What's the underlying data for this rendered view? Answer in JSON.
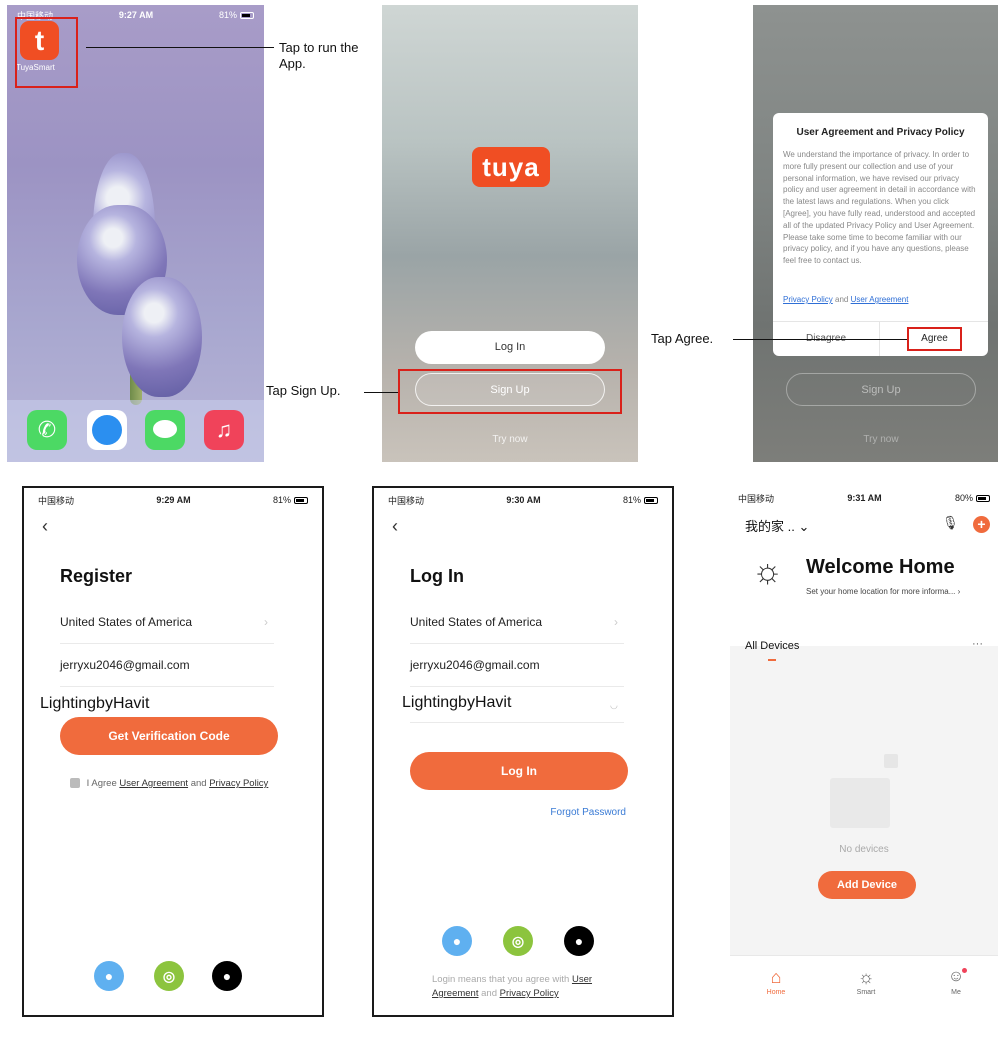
{
  "screen1": {
    "status": {
      "carrier": "中国移动",
      "time": "9:27 AM",
      "battery": "81%"
    },
    "app_label": "TuyaSmart",
    "app_icon_letter": "t",
    "callout": "Tap to run the App.",
    "dock_icons": [
      "phone-icon",
      "safari-icon",
      "messages-icon",
      "music-icon"
    ]
  },
  "screen2": {
    "logo_text": "tuya",
    "login_label": "Log In",
    "signup_label": "Sign Up",
    "try_now_label": "Try now",
    "callout": "Tap Sign Up."
  },
  "screen3": {
    "dialog_title": "User Agreement and Privacy Policy",
    "dialog_body": "We understand the importance of privacy. In order to more fully present our collection and use of your personal information, we have revised our privacy policy and user agreement in detail in accordance with the latest laws and regulations. When you click [Agree], you have fully read, understood and accepted all of the updated Privacy Policy and User Agreement. Please take some time to become familiar with our privacy policy, and if you have any questions, please feel free to contact us.",
    "link_privacy": "Privacy Policy",
    "link_and": "and",
    "link_agreement": "User Agreement",
    "disagree_label": "Disagree",
    "agree_label": "Agree",
    "bg_signup_label": "Sign Up",
    "bg_try_now_label": "Try now",
    "callout": "Tap Agree."
  },
  "screen4": {
    "status": {
      "carrier": "中国移动",
      "time": "9:29 AM",
      "battery": "81%"
    },
    "title": "Register",
    "country": "United States of America",
    "email": "jerryxu2046@gmail.com",
    "password_overlay": "LightingbyHavit",
    "button_label": "Get Verification Code",
    "agree_prefix": "I Agree",
    "agree_link1": "User Agreement",
    "agree_and": "and",
    "agree_link2": "Privacy Policy"
  },
  "screen5": {
    "status": {
      "carrier": "中国移动",
      "time": "9:30 AM",
      "battery": "81%"
    },
    "title": "Log In",
    "country": "United States of America",
    "email": "jerryxu2046@gmail.com",
    "password_overlay": "LightingbyHavit",
    "button_label": "Log In",
    "forgot_label": "Forgot Password",
    "footer_prefix": "Login means that you agree with",
    "footer_link1": "User Agreement",
    "footer_and": "and",
    "footer_link2": "Privacy Policy"
  },
  "screen6": {
    "status": {
      "carrier": "中国移动",
      "time": "9:31 AM",
      "battery": "80%"
    },
    "home_name": "我的家 ..",
    "welcome_title": "Welcome Home",
    "welcome_sub": "Set your home location for more informa...",
    "all_devices": "All Devices",
    "more": "···",
    "no_devices": "No devices",
    "add_device": "Add Device",
    "tabs": [
      {
        "label": "Home"
      },
      {
        "label": "Smart"
      },
      {
        "label": "Me"
      }
    ]
  },
  "colors": {
    "accent": "#f06b3d",
    "brand": "#f04e23",
    "callout_box": "#d9211a",
    "link": "#2f6fd6"
  }
}
